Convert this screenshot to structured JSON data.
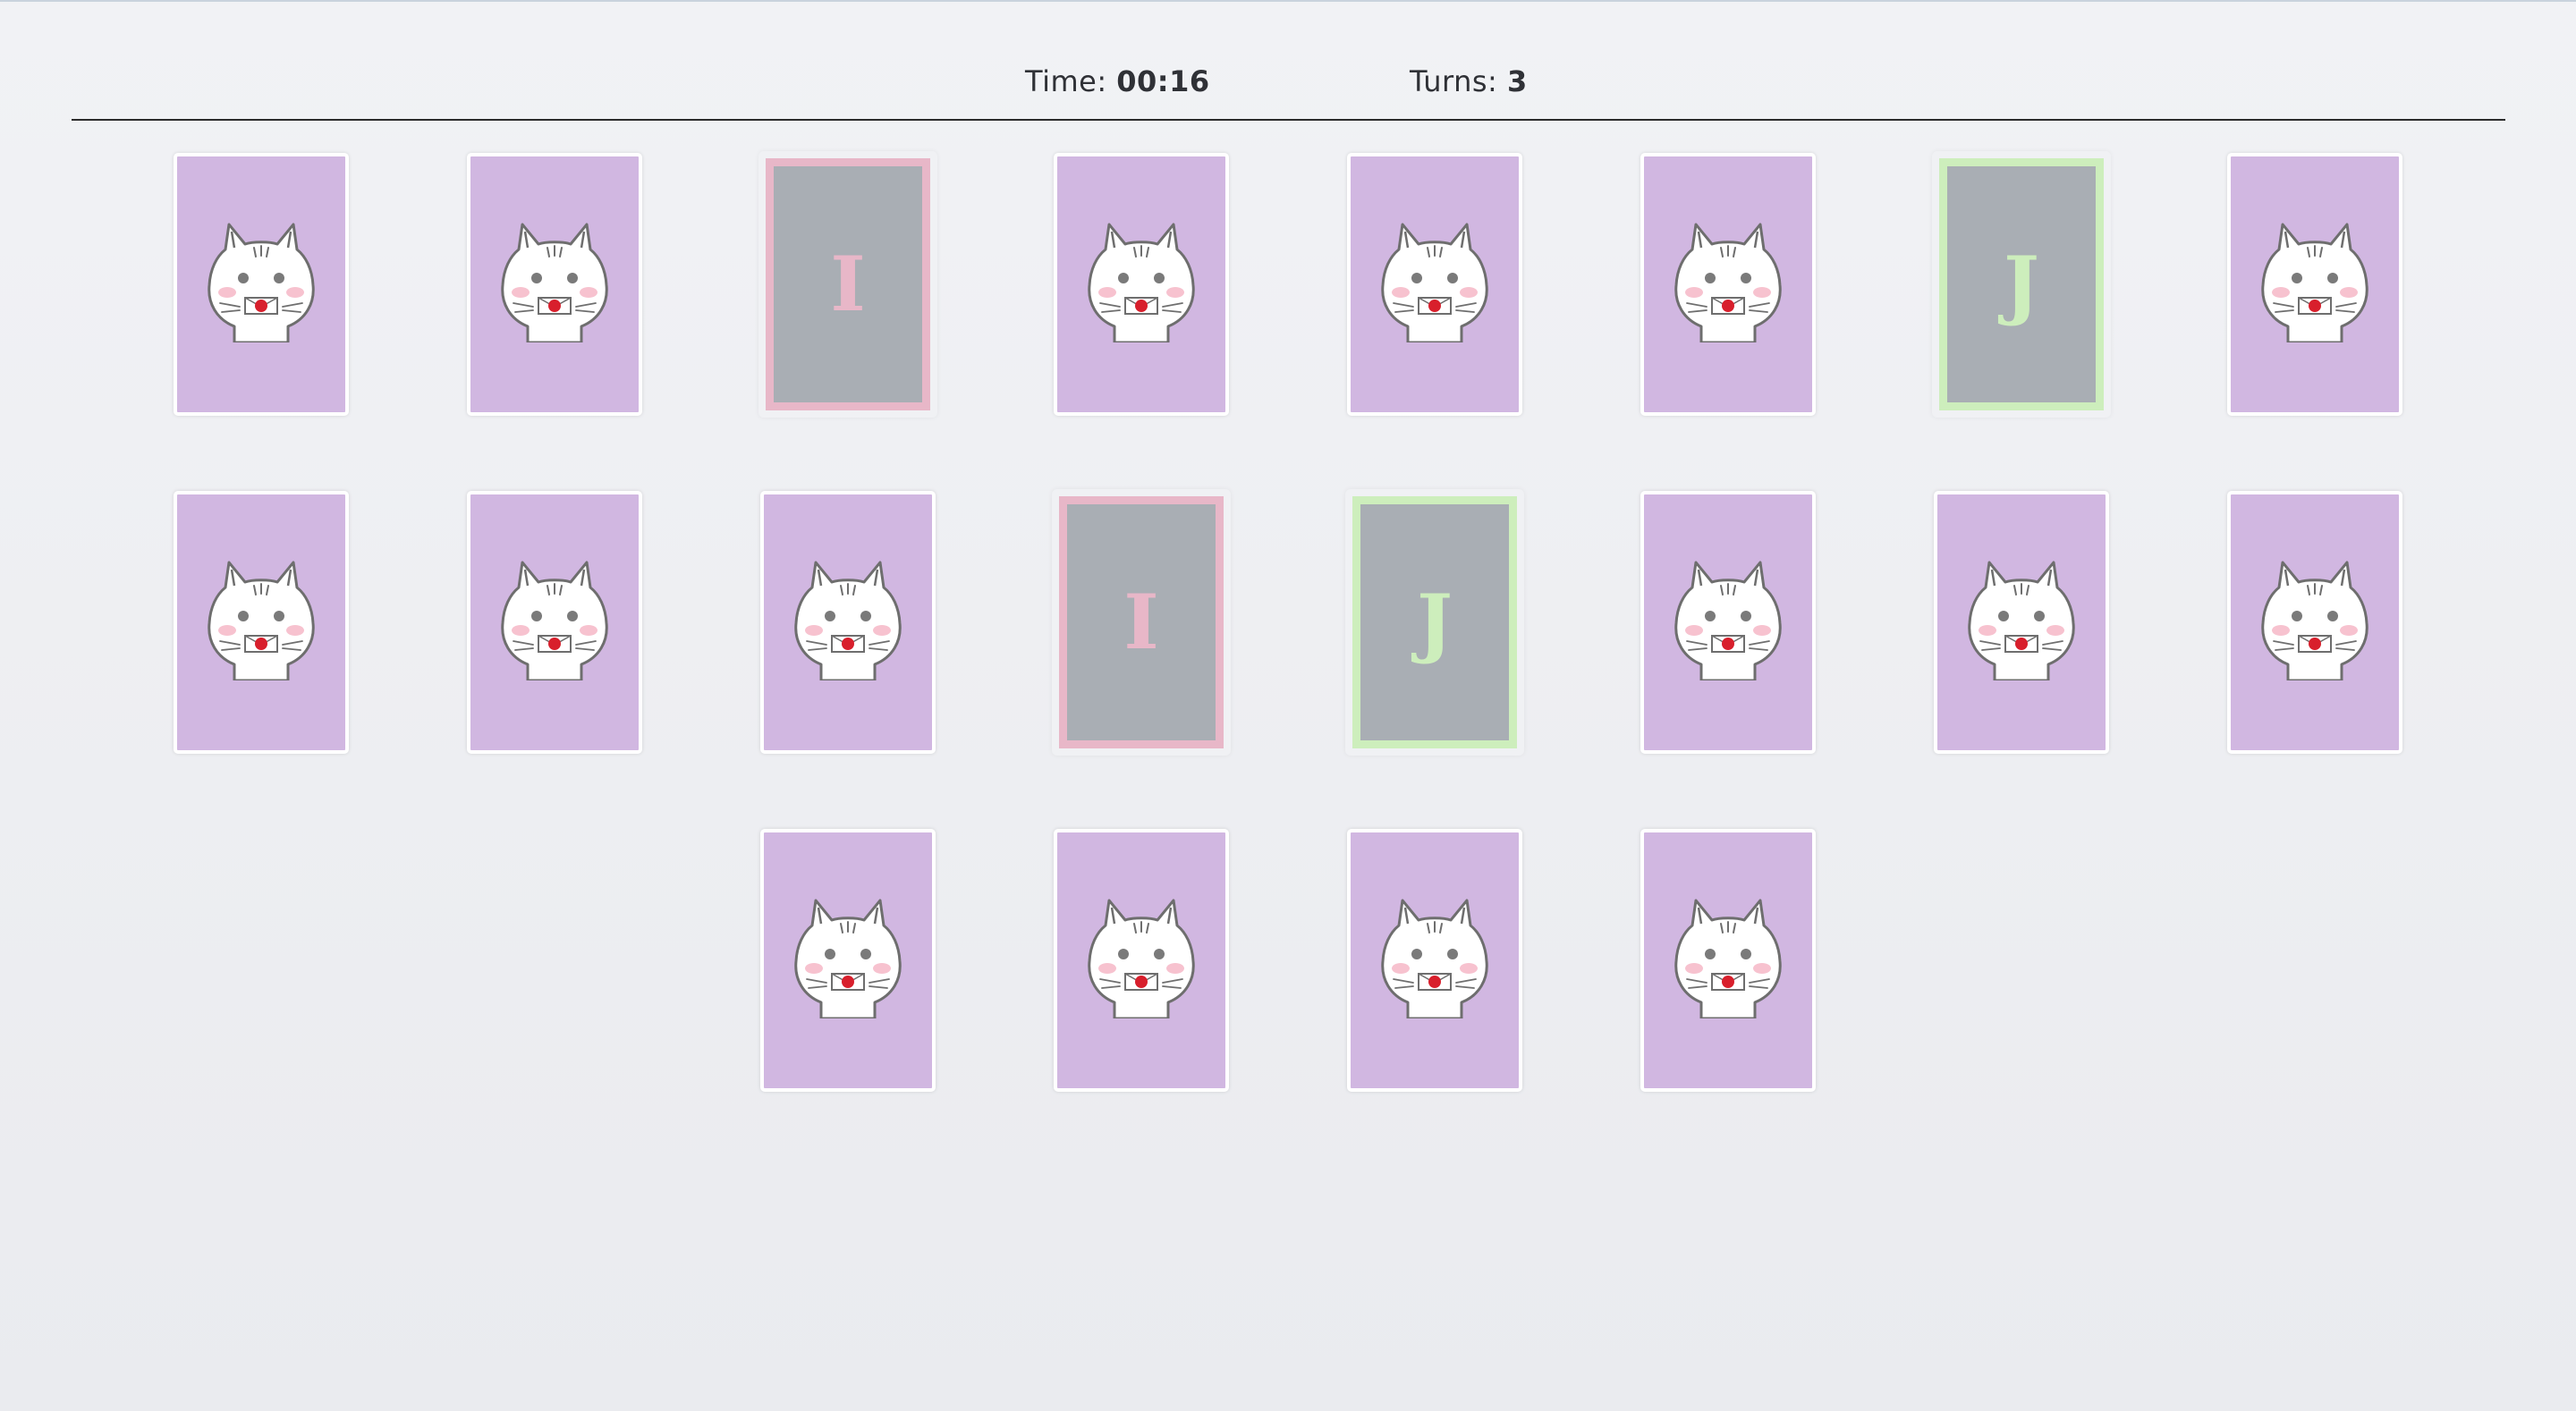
{
  "hud": {
    "time_label": "Time:",
    "time_value": "00:16",
    "turns_label": "Turns:",
    "turns_value": "3"
  },
  "colors": {
    "card_back": "#d1b7e1",
    "card_face": "#a9aeb4",
    "pair_pink": "#e8b7c8",
    "pair_green": "#cdeebc"
  },
  "card_back_icon": "cat-with-envelope-icon",
  "rows": [
    [
      {
        "state": "down"
      },
      {
        "state": "down"
      },
      {
        "state": "up",
        "letter": "I",
        "color": "#e8b7c8"
      },
      {
        "state": "down"
      },
      {
        "state": "down"
      },
      {
        "state": "down"
      },
      {
        "state": "up",
        "letter": "J",
        "color": "#cdeebc"
      },
      {
        "state": "down"
      }
    ],
    [
      {
        "state": "down"
      },
      {
        "state": "down"
      },
      {
        "state": "down"
      },
      {
        "state": "up",
        "letter": "I",
        "color": "#e8b7c8"
      },
      {
        "state": "up",
        "letter": "J",
        "color": "#cdeebc"
      },
      {
        "state": "down"
      },
      {
        "state": "down"
      },
      {
        "state": "down"
      }
    ],
    [
      {
        "state": "down"
      },
      {
        "state": "down"
      },
      {
        "state": "down"
      },
      {
        "state": "down"
      }
    ]
  ]
}
